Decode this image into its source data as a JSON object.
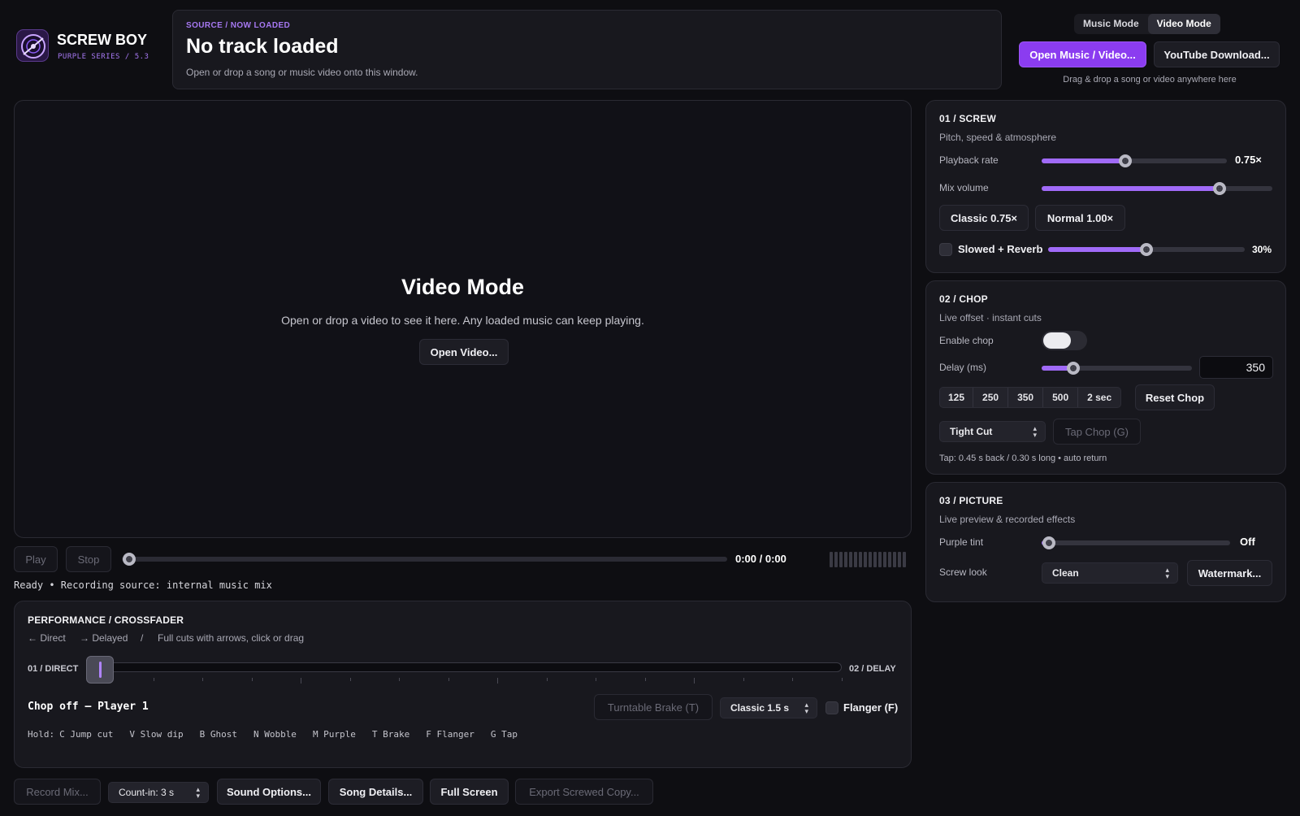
{
  "app": {
    "name": "SCREW BOY",
    "series": "PURPLE SERIES / 5.3"
  },
  "source": {
    "eyebrow": "SOURCE / NOW LOADED",
    "title": "No track loaded",
    "hint": "Open or drop a song or music video onto this window."
  },
  "mode_tabs": [
    "Music Mode",
    "Video Mode"
  ],
  "active_mode": "Video Mode",
  "top_actions": {
    "open": "Open Music / Video...",
    "youtube": "YouTube Download...",
    "hint": "Drag & drop a song or video anywhere here"
  },
  "video": {
    "title": "Video Mode",
    "subtitle": "Open or drop a video to see it here. Any loaded music can keep playing.",
    "open_button": "Open Video..."
  },
  "transport": {
    "play": "Play",
    "stop": "Stop",
    "time": "0:00 / 0:00",
    "progress": 0
  },
  "status_line": "Ready • Recording source: internal music mix",
  "performance": {
    "title": "PERFORMANCE / CROSSFADER",
    "left_hint": "← Direct",
    "right_hint": "→ Delayed",
    "sep": "/",
    "cuts_hint": "Full cuts with arrows, click or drag",
    "left_label": "01 / DIRECT",
    "right_label": "02 / DELAY",
    "position": 0,
    "status": "Chop off — Player 1",
    "brake_button": "Turntable Brake (T)",
    "brake_select": "Classic 1.5 s",
    "flanger": "Flanger (F)",
    "hold_label": "Hold:",
    "hold_keys": [
      "C Jump cut",
      "V Slow dip",
      "B Ghost",
      "N Wobble",
      "M Purple",
      "T Brake",
      "F Flanger",
      "G Tap"
    ]
  },
  "bottom_bar": {
    "record": "Record Mix...",
    "count_in": "Count-in: 3 s",
    "sound": "Sound Options...",
    "song": "Song Details...",
    "fullscreen": "Full Screen",
    "export": "Export Screwed Copy..."
  },
  "screw": {
    "title": "01 / SCREW",
    "subtitle": "Pitch, speed & atmosphere",
    "playback_label": "Playback rate",
    "playback_value": "0.75×",
    "playback_fraction": 0.45,
    "mix_label": "Mix volume",
    "mix_fraction": 0.77,
    "preset_classic": "Classic 0.75×",
    "preset_normal": "Normal 1.00×",
    "reverb_label": "Slowed + Reverb",
    "reverb_value": "30%",
    "reverb_fraction": 0.5
  },
  "chop": {
    "title": "02 / CHOP",
    "subtitle": "Live offset · instant cuts",
    "enable_label": "Enable chop",
    "delay_label": "Delay (ms)",
    "delay_value": "350",
    "delay_fraction": 0.21,
    "presets": [
      "125",
      "250",
      "350",
      "500",
      "2 sec"
    ],
    "reset": "Reset Chop",
    "mode_select": "Tight Cut",
    "tap_button": "Tap Chop (G)",
    "tap_info": "Tap: 0.45 s back / 0.30 s long • auto return"
  },
  "picture": {
    "title": "03 / PICTURE",
    "subtitle": "Live preview & recorded effects",
    "tint_label": "Purple tint",
    "tint_value": "Off",
    "tint_fraction": 0.04,
    "look_label": "Screw look",
    "look_select": "Clean",
    "watermark": "Watermark..."
  },
  "colors": {
    "accent": "#8b3cf0",
    "fill": "#a06af8",
    "bg": "#0e0e12",
    "panel": "#18181e"
  }
}
